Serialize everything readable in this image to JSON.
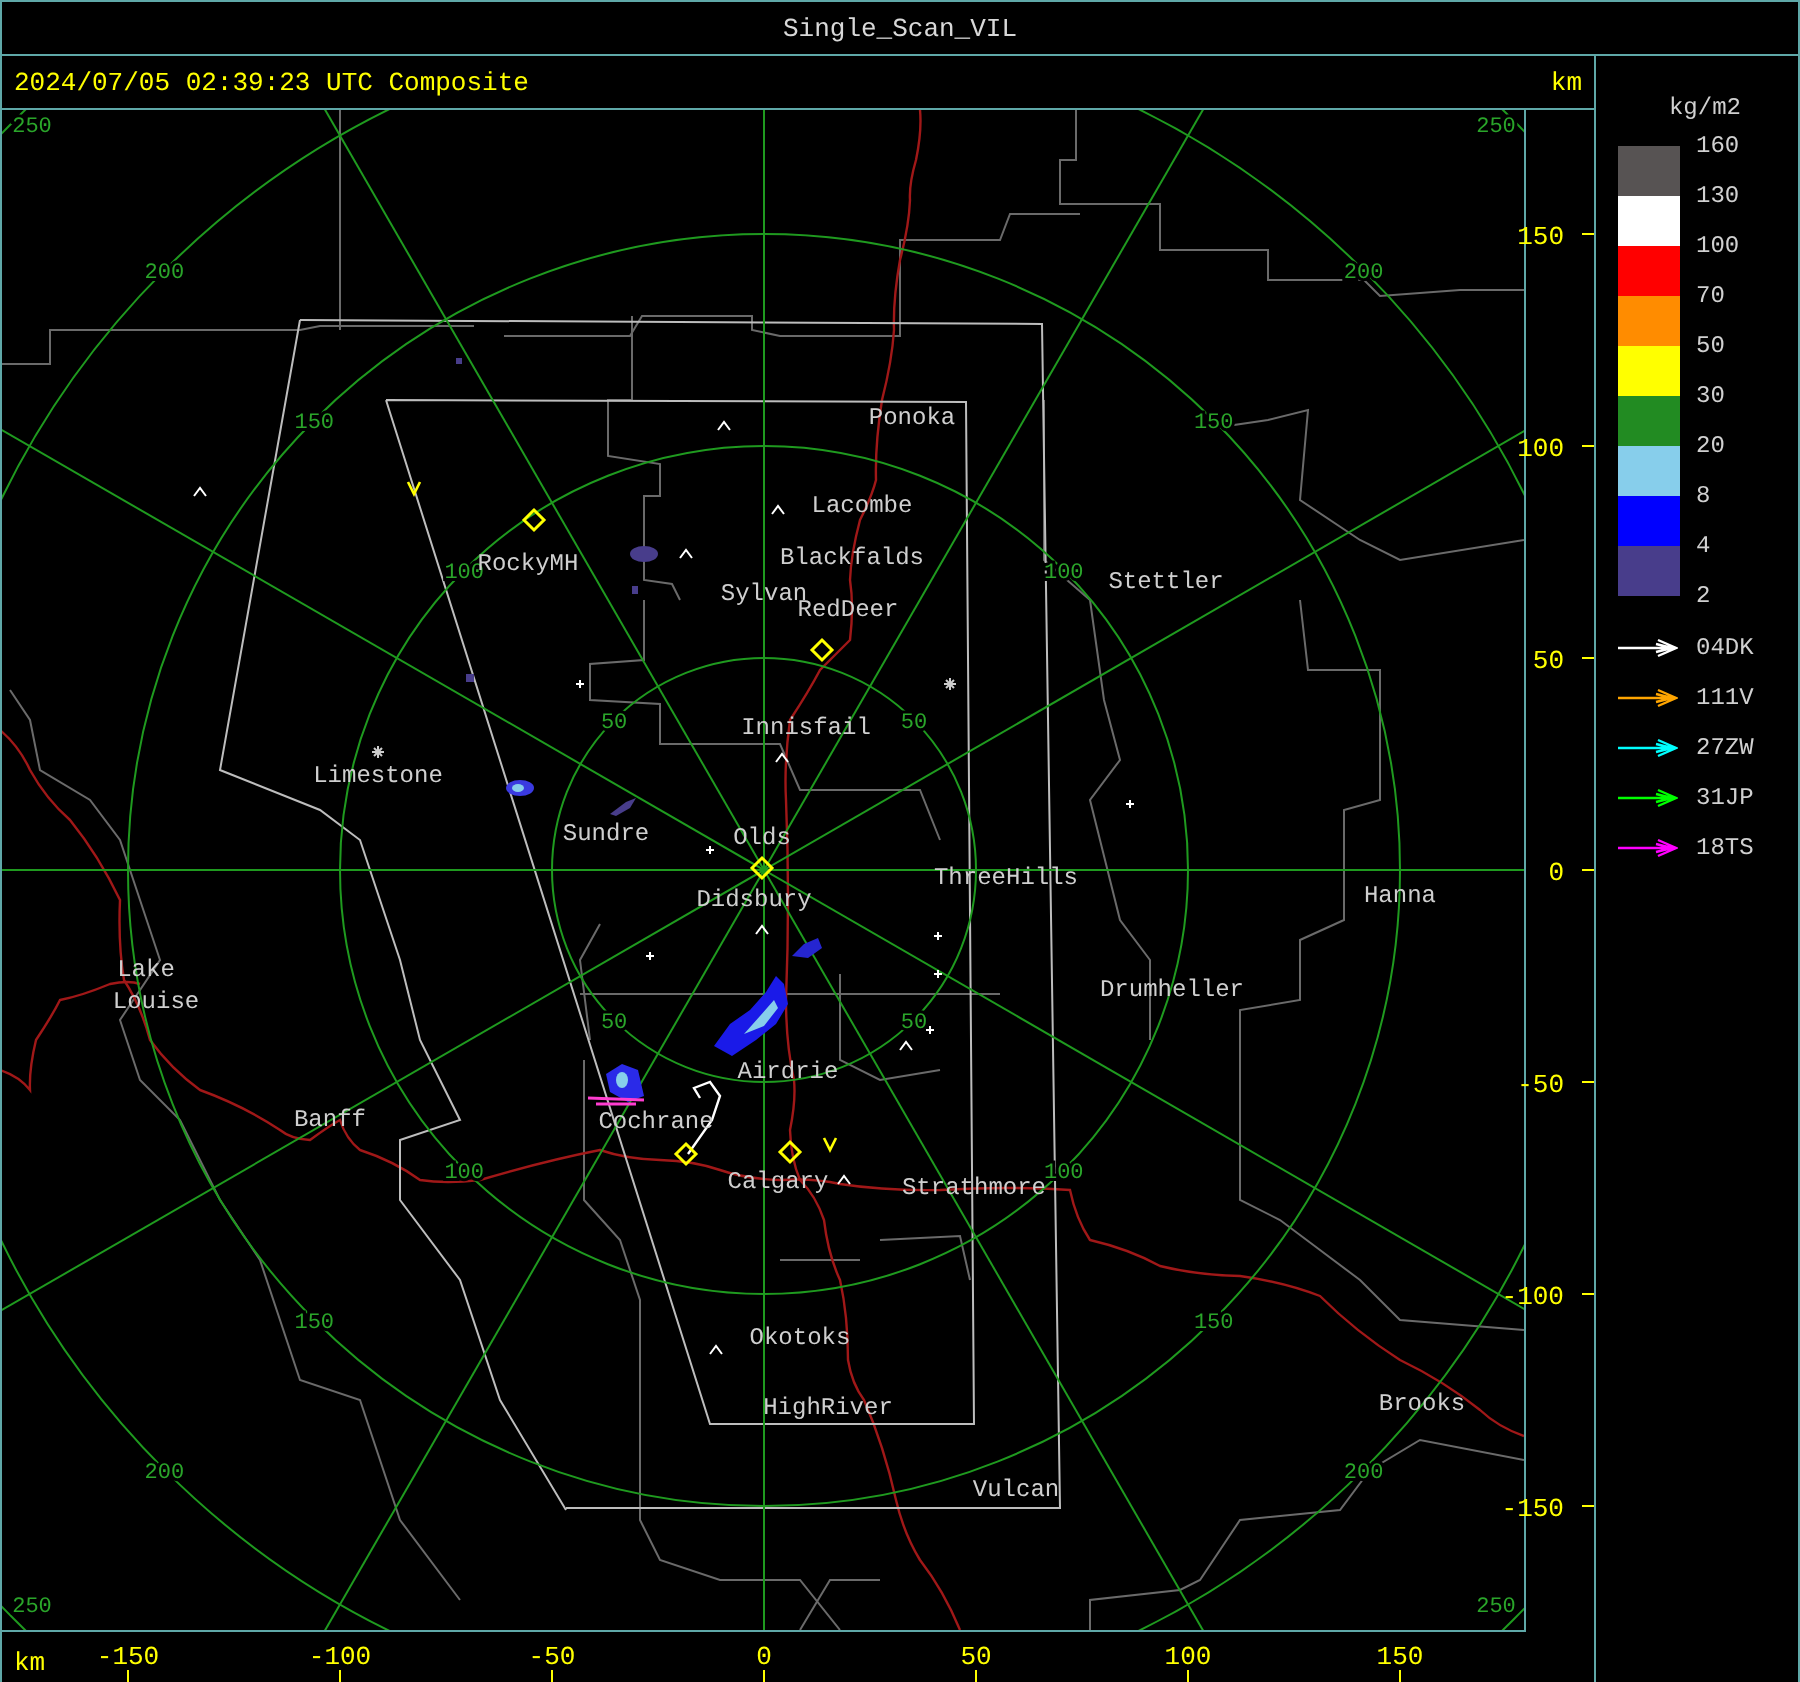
{
  "window": {
    "title": "Single_Scan_VIL"
  },
  "header": {
    "timestamp": "2024/07/05 02:39:23 UTC Composite",
    "unit": "km"
  },
  "map": {
    "places": [
      "Ponoka",
      "Lacombe",
      "Blackfalds",
      "Sylvan",
      "RedDeer",
      "Stettler",
      "RockyMH",
      "Innisfail",
      "Limestone",
      "Sundre",
      "Olds",
      "Didsbury",
      "ThreeHills",
      "Hanna",
      "Lake",
      "Louise",
      "Drumheller",
      "Airdrie",
      "Banff",
      "Cochrane",
      "Calgary",
      "Strathmore",
      "Okotoks",
      "HighRiver",
      "Brooks",
      "Vulcan"
    ],
    "range_ring_labels": [
      {
        "labels": [
          "50",
          "100",
          "150",
          "200",
          "250"
        ]
      },
      {
        "labels": [
          "50",
          "100",
          "150",
          "200",
          "250"
        ]
      },
      {
        "labels": [
          "50",
          "100",
          "150",
          "200",
          "250"
        ]
      },
      {
        "labels": [
          "50",
          "100",
          "150",
          "200",
          "250"
        ]
      }
    ]
  },
  "y_axis": {
    "ticks": [
      "150",
      "100",
      "50",
      "0",
      "-50",
      "-100",
      "-150"
    ]
  },
  "x_axis": {
    "unit": "km",
    "ticks": [
      "-150",
      "-100",
      "-50",
      "0",
      "50",
      "100",
      "150"
    ]
  },
  "legend": {
    "unit": "kg/m2",
    "levels": [
      "160",
      "130",
      "100",
      "70",
      "50",
      "30",
      "20",
      "8",
      "4",
      "2"
    ],
    "swatches": [
      {
        "color": "#575353"
      },
      {
        "color": "#ffffff"
      },
      {
        "color": "#ff0000"
      },
      {
        "color": "#ff8c00"
      },
      {
        "color": "#ffff00"
      },
      {
        "color": "#228b22"
      },
      {
        "color": "#87ceeb"
      },
      {
        "color": "#0000ff"
      },
      {
        "color": "#483d8b"
      }
    ],
    "tracks": [
      {
        "label": "04DK",
        "color": "#ffffff"
      },
      {
        "label": "111V",
        "color": "#ffa500"
      },
      {
        "label": "27ZW",
        "color": "#00ffff"
      },
      {
        "label": "31JP",
        "color": "#00ff00"
      },
      {
        "label": "18TS",
        "color": "#ff00ff"
      }
    ]
  }
}
